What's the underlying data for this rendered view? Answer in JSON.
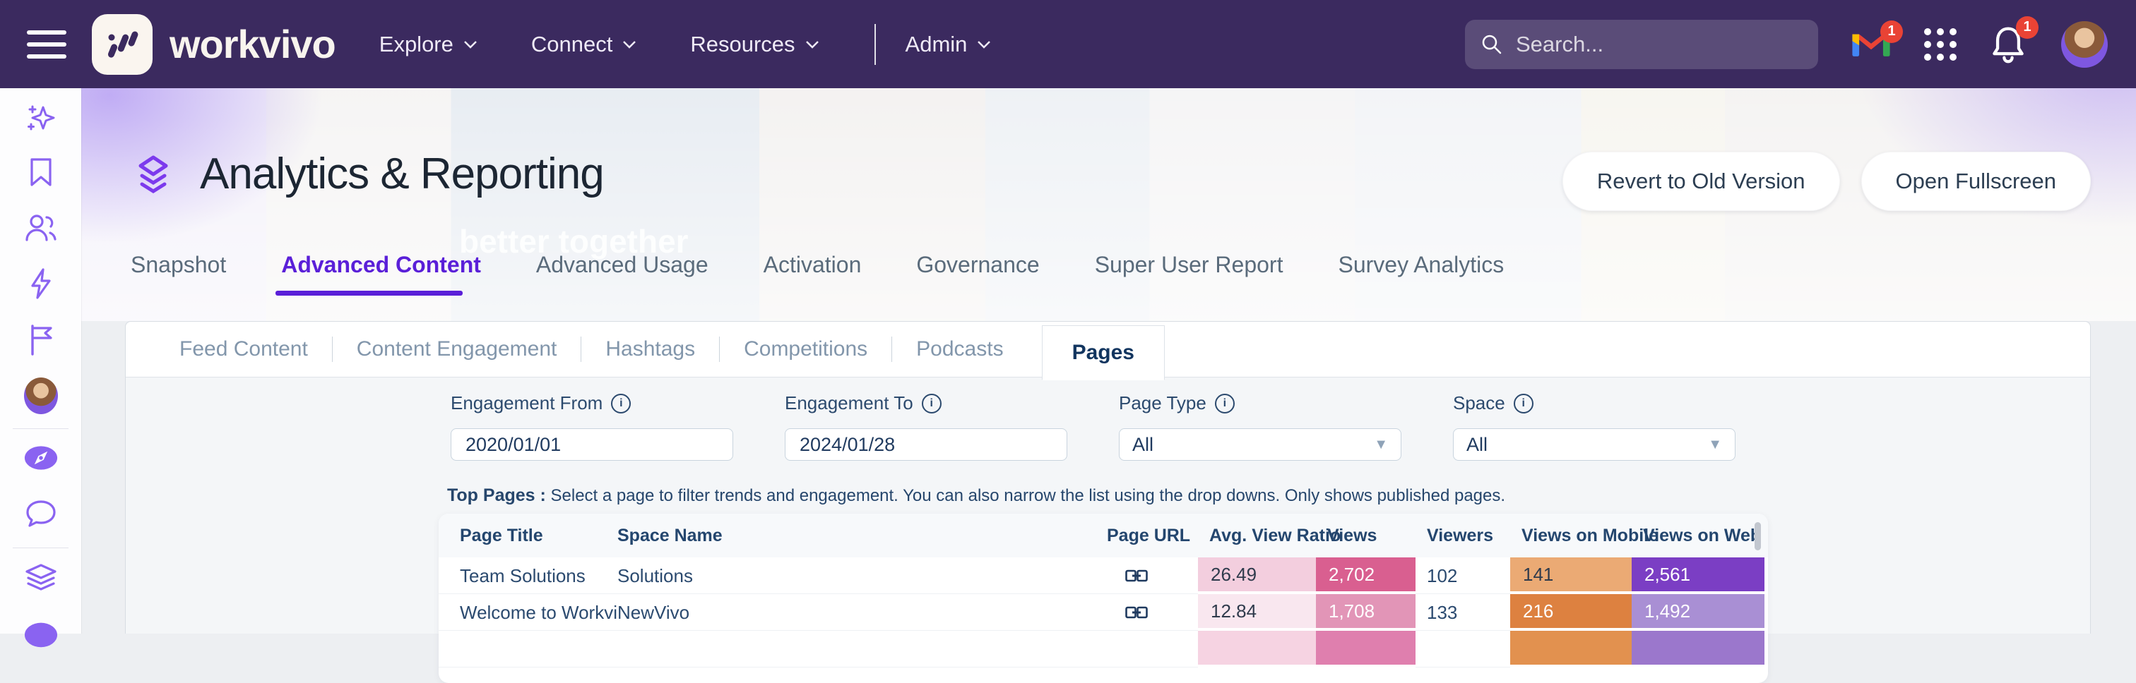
{
  "navbar": {
    "brand": "workvivo",
    "menu": [
      "Explore",
      "Connect",
      "Resources"
    ],
    "admin_label": "Admin",
    "search_placeholder": "Search...",
    "gmail_badge": "1",
    "notifications_badge": "1"
  },
  "sidebar": {
    "icons": [
      "sparkles",
      "bookmark",
      "people",
      "lightning",
      "flag",
      "user-avatar",
      "compass",
      "chat",
      "layers",
      "profile-partial"
    ]
  },
  "hero": {
    "title": "Analytics & Reporting",
    "watermark": "better together",
    "revert_button": "Revert to Old Version",
    "fullscreen_button": "Open Fullscreen",
    "tabs": [
      "Snapshot",
      "Advanced Content",
      "Advanced Usage",
      "Activation",
      "Governance",
      "Super User Report",
      "Survey Analytics"
    ],
    "active_tab": "Advanced Content"
  },
  "content": {
    "subtabs": [
      "Feed Content",
      "Content Engagement",
      "Hashtags",
      "Competitions",
      "Podcasts",
      "Pages"
    ],
    "active_subtab": "Pages",
    "filters": [
      {
        "label": "Engagement From",
        "value": "2020/01/01",
        "type": "input"
      },
      {
        "label": "Engagement To",
        "value": "2024/01/28",
        "type": "input"
      },
      {
        "label": "Page Type",
        "value": "All",
        "type": "select"
      },
      {
        "label": "Space",
        "value": "All",
        "type": "select"
      }
    ],
    "top_pages": {
      "label": "Top Pages :",
      "description": "Select a page to filter trends and engagement. You can also narrow the list using the drop downs. Only shows published pages."
    },
    "table": {
      "columns": [
        "Page Title",
        "Space Name",
        "Page URL",
        "Avg. View Ratio",
        "Views",
        "Viewers",
        "Views on Mobile",
        "Views on Web"
      ],
      "rows": [
        {
          "title": "Team Solutions",
          "space": "Solutions",
          "cells": [
            {
              "v": "26.49",
              "bg": "#f3cede",
              "fg": "#2f3b4c"
            },
            {
              "v": "2,702",
              "bg": "#d95f90",
              "fg": "#ffffff"
            },
            {
              "v": "102",
              "bg": "#ffffff",
              "fg": "#1f3a5f"
            },
            {
              "v": "141",
              "bg": "#ebaa74",
              "fg": "#2f3b4c"
            },
            {
              "v": "2,561",
              "bg": "#7b3ec4",
              "fg": "#ffffff"
            }
          ]
        },
        {
          "title": "Welcome to Workvivo",
          "space": "NewVivo",
          "cells": [
            {
              "v": "12.84",
              "bg": "#f9e7ef",
              "fg": "#2f3b4c"
            },
            {
              "v": "1,708",
              "bg": "#e295b7",
              "fg": "#ffffff"
            },
            {
              "v": "133",
              "bg": "#ffffff",
              "fg": "#1f3a5f"
            },
            {
              "v": "216",
              "bg": "#dd8140",
              "fg": "#ffffff"
            },
            {
              "v": "1,492",
              "bg": "#a98fd4",
              "fg": "#ffffff"
            }
          ]
        }
      ],
      "partial_row_colors": [
        "#f6d3e2",
        "#df7fae",
        "#ffffff",
        "#e2914f",
        "#9b77cc"
      ]
    }
  },
  "colors": {
    "navbar_bg": "#3b2a5f",
    "accent_purple": "#5a1fd8",
    "sidebar_icon": "#8a63f1",
    "navy_text": "#1f3a5f",
    "badge_red": "#e94335",
    "panel_bg": "#f4f6f8"
  }
}
